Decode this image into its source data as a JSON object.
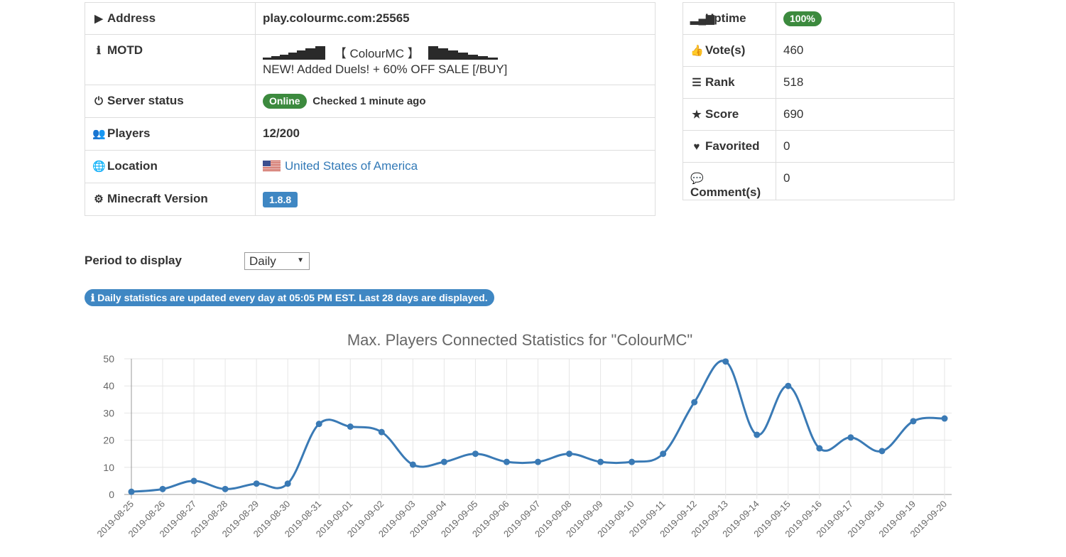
{
  "server_info": {
    "address": {
      "label": "Address",
      "value": "play.colourmc.com:25565",
      "icon": "play-icon"
    },
    "motd": {
      "label": "MOTD",
      "line1": "【 ColourMC 】",
      "line2": "NEW! Added Duels! + 60% OFF SALE [/BUY]",
      "icon": "info-circle-icon"
    },
    "status": {
      "label": "Server status",
      "badge": "Online",
      "checked": "Checked 1 minute ago",
      "icon": "power-icon"
    },
    "players": {
      "label": "Players",
      "value": "12/200",
      "icon": "users-icon"
    },
    "location": {
      "label": "Location",
      "value": "United States of America",
      "icon": "globe-icon"
    },
    "version": {
      "label": "Minecraft Version",
      "value": "1.8.8",
      "icon": "gear-icon"
    }
  },
  "side_stats": [
    {
      "label": "Uptime",
      "value": "100%",
      "icon": "signal-icon",
      "badge": true
    },
    {
      "label": "Vote(s)",
      "value": "460",
      "icon": "thumbs-up-icon"
    },
    {
      "label": "Rank",
      "value": "518",
      "icon": "ordered-list-icon"
    },
    {
      "label": "Score",
      "value": "690",
      "icon": "star-icon"
    },
    {
      "label": "Favorited",
      "value": "0",
      "icon": "heart-icon"
    },
    {
      "label": "Comment(s)",
      "value": "0",
      "icon": "comments-icon"
    }
  ],
  "period": {
    "label": "Period to display",
    "selected": "Daily"
  },
  "info_notice": "Daily statistics are updated every day at 05:05 PM EST. Last 28 days are displayed.",
  "colors": {
    "accent_blue": "#3f87c3",
    "online_green": "#3c8a3e",
    "line": "#3a7ab5"
  },
  "chart_data": {
    "type": "line",
    "title": "Max. Players Connected Statistics for \"ColourMC\"",
    "ylim": [
      0,
      50
    ],
    "yticks": [
      0,
      10,
      20,
      30,
      40,
      50
    ],
    "grid": true,
    "x": [
      "2019-08-25",
      "2019-08-26",
      "2019-08-27",
      "2019-08-28",
      "2019-08-29",
      "2019-08-30",
      "2019-08-31",
      "2019-09-01",
      "2019-09-02",
      "2019-09-03",
      "2019-09-04",
      "2019-09-05",
      "2019-09-06",
      "2019-09-07",
      "2019-09-08",
      "2019-09-09",
      "2019-09-10",
      "2019-09-11",
      "2019-09-12",
      "2019-09-13",
      "2019-09-14",
      "2019-09-15",
      "2019-09-16",
      "2019-09-17",
      "2019-09-18",
      "2019-09-19",
      "2019-09-20"
    ],
    "values": [
      1,
      2,
      5,
      2,
      4,
      4,
      26,
      25,
      23,
      11,
      12,
      15,
      12,
      12,
      15,
      12,
      12,
      15,
      34,
      49,
      22,
      40,
      17,
      21,
      16,
      27,
      28
    ]
  }
}
